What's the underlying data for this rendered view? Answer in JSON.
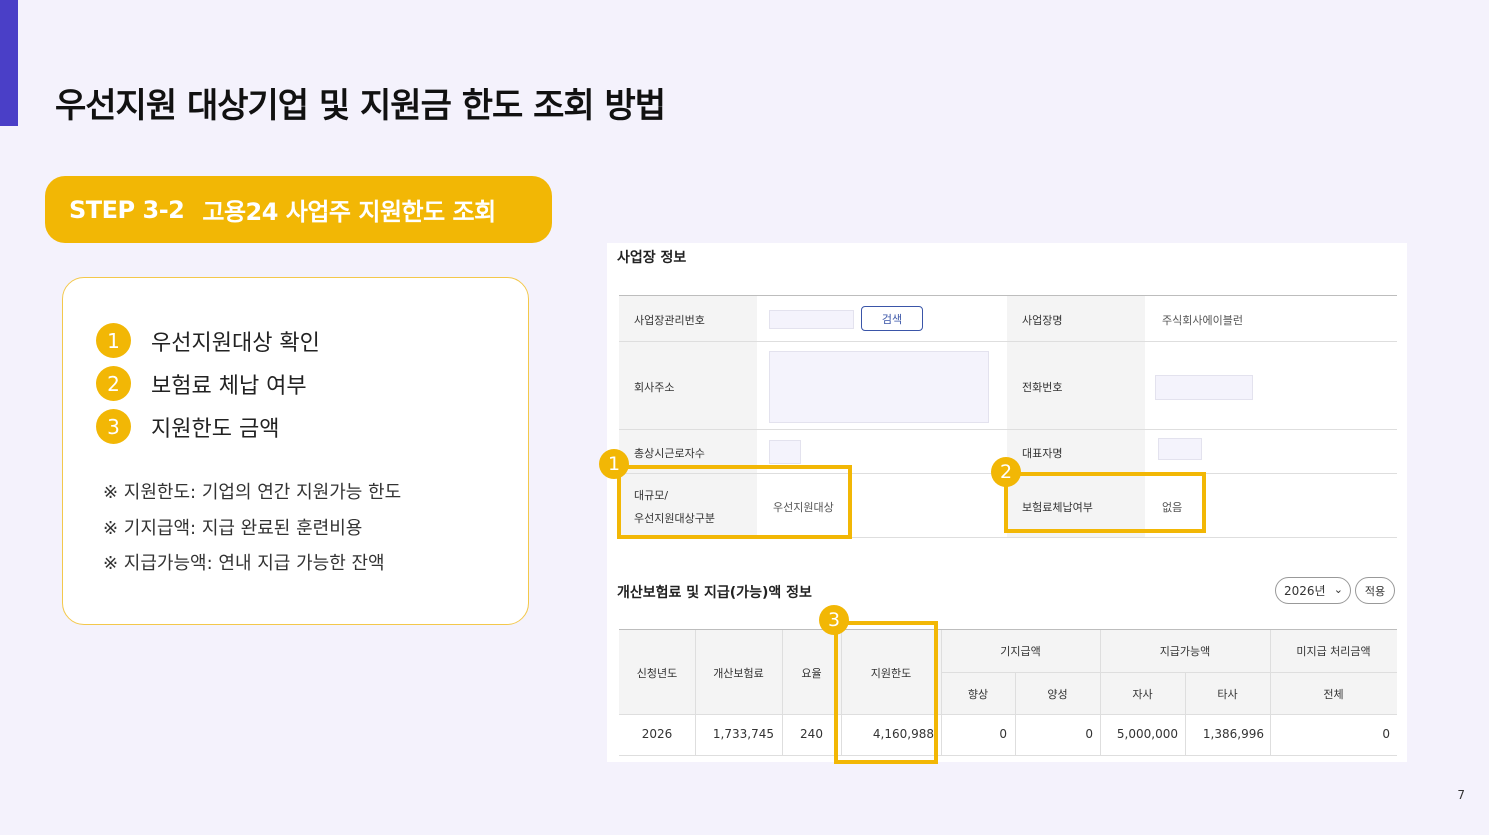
{
  "title": "우선지원 대상기업 및 지원금 한도 조회 방법",
  "step": {
    "code": "STEP 3-2",
    "label": "고용24 사업주 지원한도 조회"
  },
  "card": {
    "items": [
      {
        "num": "1",
        "text": "우선지원대상 확인"
      },
      {
        "num": "2",
        "text": "보험료 체납 여부"
      },
      {
        "num": "3",
        "text": "지원한도 금액"
      }
    ],
    "notes": [
      "※ 지원한도: 기업의 연간 지원가능 한도",
      "※ 기지급액: 지급 완료된 훈련비용",
      "※ 지급가능액: 연내 지급 가능한 잔액"
    ]
  },
  "screenshot": {
    "section1_title": "사업장 정보",
    "labels": {
      "biz_no": "사업장관리번호",
      "biz_name": "사업장명",
      "address": "회사주소",
      "phone": "전화번호",
      "workers": "총상시근로자수",
      "ceo": "대표자명",
      "size_line1": "대규모/",
      "size_line2": "우선지원대상구분",
      "arrears": "보험료체납여부"
    },
    "values": {
      "biz_name": "주식회사에이블런",
      "size": "우선지원대상",
      "arrears": "없음"
    },
    "search_label": "검색",
    "section2_title": "개산보험료 및 지급(가능)액 정보",
    "year_select": "2026년",
    "apply_label": "적용",
    "table": {
      "headers": {
        "year": "신청년도",
        "premium": "개산보험료",
        "rate": "요율",
        "limit": "지원한도",
        "paid": "기지급액",
        "payable": "지급가능액",
        "unpaid": "미지급 처리금액"
      },
      "subheaders": {
        "improve": "향상",
        "train": "양성",
        "own": "자사",
        "other": "타사",
        "total": "전체"
      },
      "row": {
        "year": "2026",
        "premium": "1,733,745",
        "rate": "240",
        "limit": "4,160,988",
        "paid_improve": "0",
        "paid_train": "0",
        "own": "5,000,000",
        "other": "1,386,996",
        "unpaid_total": "0"
      }
    },
    "markers": [
      "1",
      "2",
      "3"
    ]
  },
  "page_number": "7",
  "colors": {
    "accent": "#4a3fc7",
    "highlight": "#f2b705",
    "background": "#f4f2fc"
  }
}
